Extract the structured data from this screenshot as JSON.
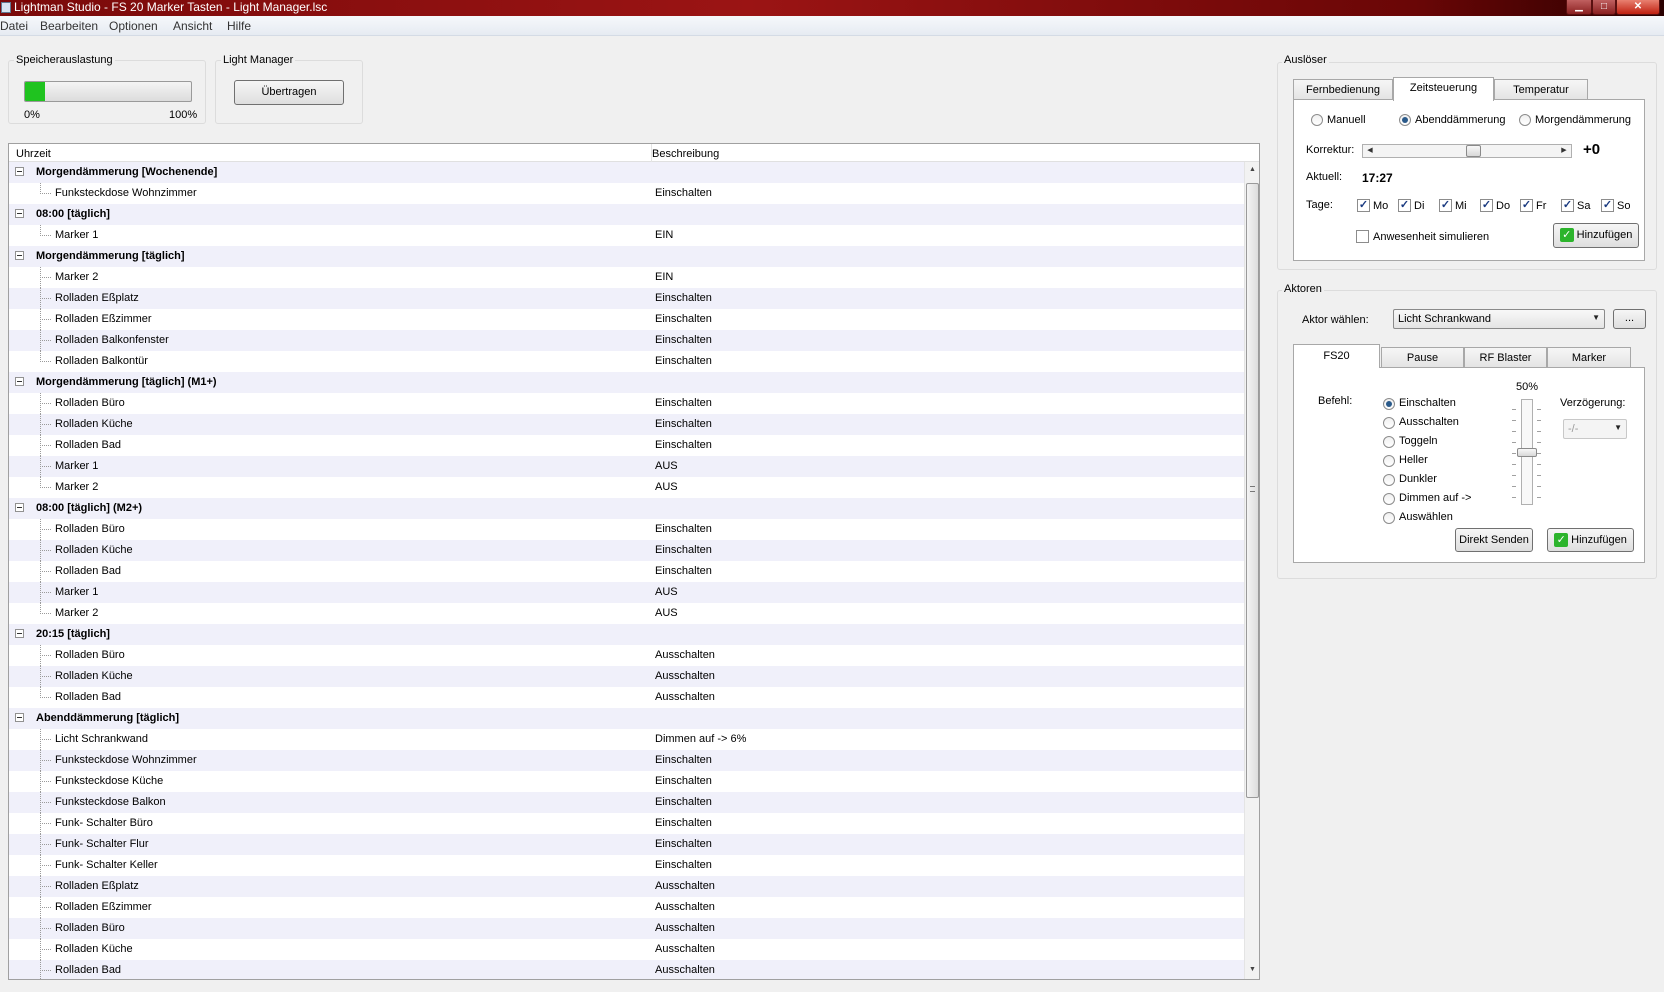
{
  "window": {
    "title": "Lightman Studio - FS 20 Marker Tasten - Light Manager.lsc",
    "min_glyph": "▁",
    "max_glyph": "□",
    "close_glyph": "✕"
  },
  "menu": {
    "items": [
      "Datei",
      "Bearbeiten",
      "Optionen",
      "Ansicht",
      "Hilfe"
    ]
  },
  "memory": {
    "title": "Speicherauslastung",
    "fill_fraction": 0.12,
    "fill_color": "#1fc31f",
    "min_label": "0%",
    "max_label": "100%"
  },
  "light_manager": {
    "title": "Light Manager",
    "transfer_label": "Übertragen"
  },
  "tree": {
    "col_time": "Uhrzeit",
    "col_desc": "Beschreibung",
    "rows": [
      {
        "type": "group",
        "label": "Morgendämmerung [Wochenende]",
        "desc": ""
      },
      {
        "type": "item",
        "label": "Funksteckdose Wohnzimmer",
        "desc": "Einschalten",
        "last": true
      },
      {
        "type": "group",
        "label": "08:00 [täglich]",
        "desc": ""
      },
      {
        "type": "item",
        "label": "Marker 1",
        "desc": "EIN",
        "last": true
      },
      {
        "type": "group",
        "label": "Morgendämmerung [täglich]",
        "desc": ""
      },
      {
        "type": "item",
        "label": "Marker 2",
        "desc": "EIN"
      },
      {
        "type": "item",
        "label": "Rolladen Eßplatz",
        "desc": "Einschalten"
      },
      {
        "type": "item",
        "label": "Rolladen Eßzimmer",
        "desc": "Einschalten"
      },
      {
        "type": "item",
        "label": "Rolladen Balkonfenster",
        "desc": "Einschalten"
      },
      {
        "type": "item",
        "label": "Rolladen Balkontür",
        "desc": "Einschalten",
        "last": true
      },
      {
        "type": "group",
        "label": "Morgendämmerung [täglich] (M1+)",
        "desc": ""
      },
      {
        "type": "item",
        "label": "Rolladen Büro",
        "desc": "Einschalten"
      },
      {
        "type": "item",
        "label": "Rolladen Küche",
        "desc": "Einschalten"
      },
      {
        "type": "item",
        "label": "Rolladen Bad",
        "desc": "Einschalten"
      },
      {
        "type": "item",
        "label": "Marker 1",
        "desc": "AUS"
      },
      {
        "type": "item",
        "label": "Marker 2",
        "desc": "AUS",
        "last": true
      },
      {
        "type": "group",
        "label": "08:00 [täglich] (M2+)",
        "desc": ""
      },
      {
        "type": "item",
        "label": "Rolladen Büro",
        "desc": "Einschalten"
      },
      {
        "type": "item",
        "label": "Rolladen Küche",
        "desc": "Einschalten"
      },
      {
        "type": "item",
        "label": "Rolladen Bad",
        "desc": "Einschalten"
      },
      {
        "type": "item",
        "label": "Marker 1",
        "desc": "AUS"
      },
      {
        "type": "item",
        "label": "Marker 2",
        "desc": "AUS",
        "last": true
      },
      {
        "type": "group",
        "label": "20:15 [täglich]",
        "desc": ""
      },
      {
        "type": "item",
        "label": "Rolladen Büro",
        "desc": "Ausschalten"
      },
      {
        "type": "item",
        "label": "Rolladen Küche",
        "desc": "Ausschalten"
      },
      {
        "type": "item",
        "label": "Rolladen Bad",
        "desc": "Ausschalten",
        "last": true
      },
      {
        "type": "group",
        "label": "Abenddämmerung [täglich]",
        "desc": ""
      },
      {
        "type": "item",
        "label": "Licht Schrankwand",
        "desc": "Dimmen auf -> 6%"
      },
      {
        "type": "item",
        "label": "Funksteckdose Wohnzimmer",
        "desc": "Einschalten"
      },
      {
        "type": "item",
        "label": "Funksteckdose Küche",
        "desc": "Einschalten"
      },
      {
        "type": "item",
        "label": "Funksteckdose  Balkon",
        "desc": "Einschalten"
      },
      {
        "type": "item",
        "label": "Funk- Schalter Büro",
        "desc": "Einschalten"
      },
      {
        "type": "item",
        "label": "Funk- Schalter Flur",
        "desc": "Einschalten"
      },
      {
        "type": "item",
        "label": "Funk- Schalter Keller",
        "desc": "Einschalten"
      },
      {
        "type": "item",
        "label": "Rolladen Eßplatz",
        "desc": "Ausschalten"
      },
      {
        "type": "item",
        "label": "Rolladen Eßzimmer",
        "desc": "Ausschalten"
      },
      {
        "type": "item",
        "label": "Rolladen Büro",
        "desc": "Ausschalten"
      },
      {
        "type": "item",
        "label": "Rolladen Küche",
        "desc": "Ausschalten"
      },
      {
        "type": "item",
        "label": "Rolladen Bad",
        "desc": "Ausschalten"
      }
    ]
  },
  "trigger": {
    "title": "Auslöser",
    "tabs": [
      "Fernbedienung",
      "Zeitsteuerung",
      "Temperatur"
    ],
    "active_tab": "Zeitsteuerung",
    "modes": [
      "Manuell",
      "Abenddämmerung",
      "Morgendämmerung"
    ],
    "selected_mode": "Abenddämmerung",
    "correction_label": "Korrektur:",
    "correction_value": "+0",
    "current_label": "Aktuell:",
    "current_value": "17:27",
    "days_label": "Tage:",
    "days": [
      "Mo",
      "Di",
      "Mi",
      "Do",
      "Fr",
      "Sa",
      "So"
    ],
    "days_checked": [
      true,
      true,
      true,
      true,
      true,
      true,
      true
    ],
    "simulate_label": "Anwesenheit simulieren",
    "simulate_checked": false,
    "add_label": "Hinzufügen"
  },
  "actors": {
    "title": "Aktoren",
    "choose_label": "Aktor wählen:",
    "selected_actor": "Licht Schrankwand",
    "more_label": "...",
    "tabs": [
      "FS20",
      "Pause",
      "RF Blaster",
      "Marker"
    ],
    "active_tab": "FS20",
    "command_label": "Befehl:",
    "commands": [
      "Einschalten",
      "Ausschalten",
      "Toggeln",
      "Heller",
      "Dunkler",
      "Dimmen auf ->",
      "Auswählen"
    ],
    "selected_command": "Einschalten",
    "dim_value": "50%",
    "dim_fraction": 0.5,
    "delay_label": "Verzögerung:",
    "delay_value": "-/-",
    "send_label": "Direkt Senden",
    "add_label": "Hinzufügen"
  },
  "icons": {
    "checkmark": "✓",
    "arrow_up": "▲",
    "arrow_down": "▼",
    "arrow_left": "◀",
    "arrow_right": "▶",
    "dropdown": "▼"
  }
}
